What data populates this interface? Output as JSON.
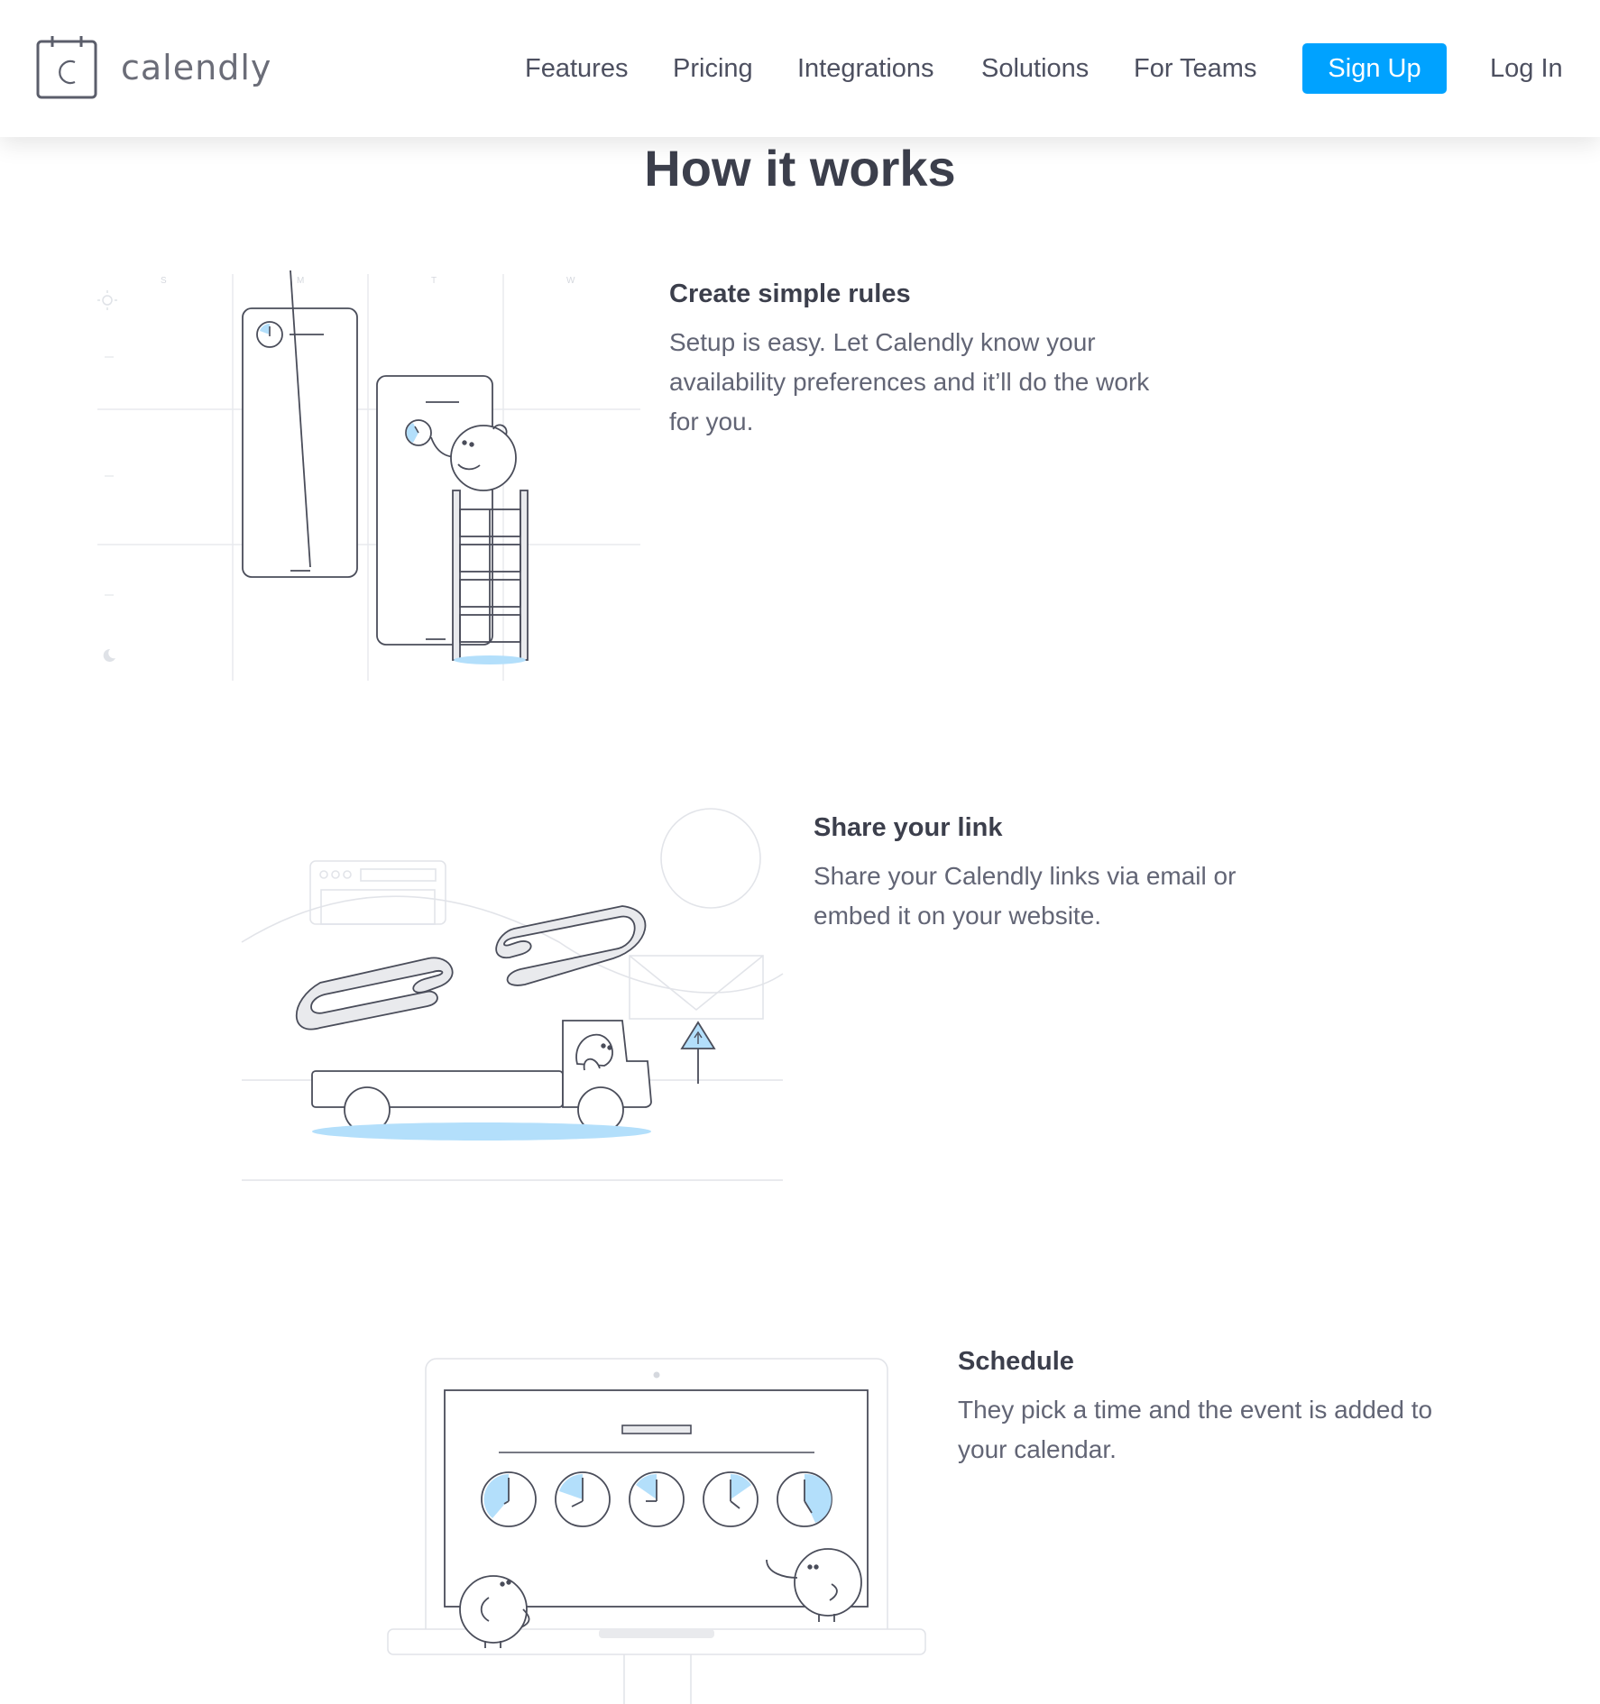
{
  "header": {
    "logo_text": "calendly",
    "nav": [
      {
        "label": "Features"
      },
      {
        "label": "Pricing"
      },
      {
        "label": "Integrations"
      },
      {
        "label": "Solutions"
      },
      {
        "label": "For Teams"
      }
    ],
    "signup_label": "Sign Up",
    "login_label": "Log In"
  },
  "title": "How it works",
  "steps": [
    {
      "heading": "Create simple rules",
      "body": "Setup is easy. Let Calendly know your availability preferences and it’ll do the work for you."
    },
    {
      "heading": "Share your link",
      "body": "Share your Calendly links via email or embed it on your website."
    },
    {
      "heading": "Schedule",
      "body": "They pick a time and the event is added to your calendar."
    }
  ],
  "illustration1": {
    "day_labels": [
      "S",
      "M",
      "T",
      "W"
    ]
  },
  "colors": {
    "accent": "#00a2ff",
    "light_blue": "#b3dffb",
    "outline": "#4a4d5a",
    "faint": "#e3e5ea"
  }
}
